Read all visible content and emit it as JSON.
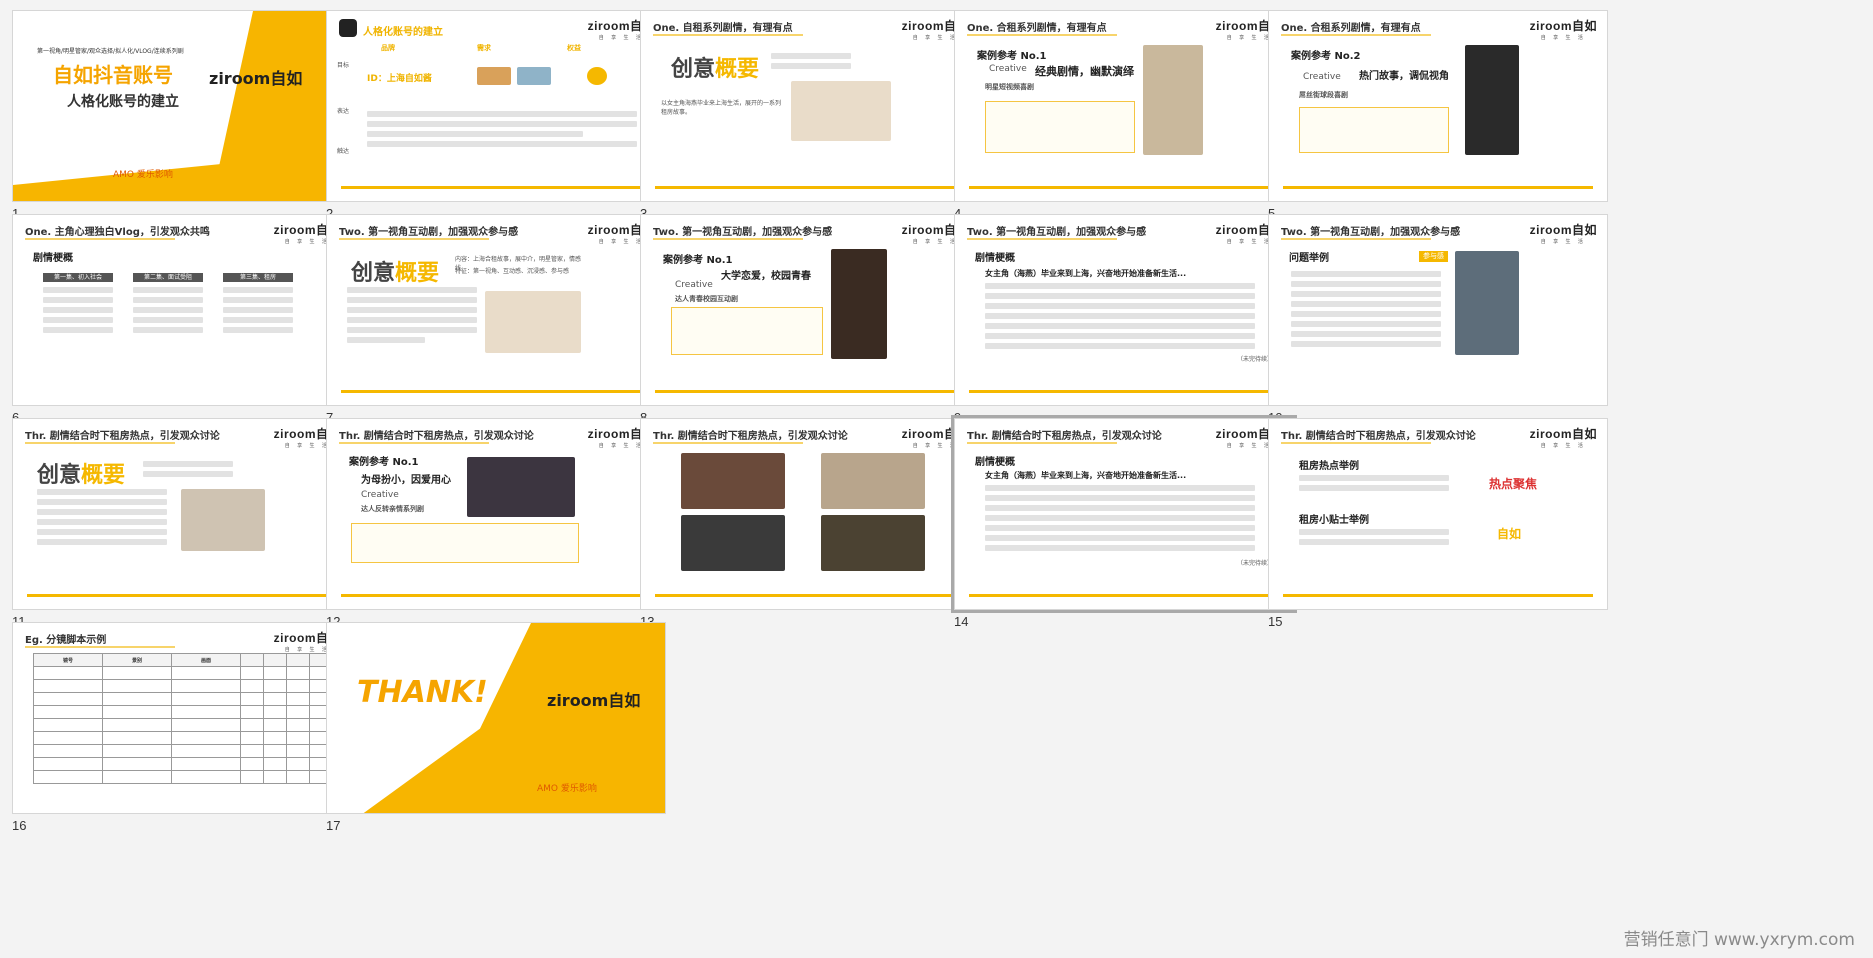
{
  "slides": [
    {
      "num": "1",
      "line1": "第一视角/明星管家/观众选择/拟人化/VLOG/连续系列剧",
      "title": "自如抖音账号",
      "subtitle": "人格化账号的建立",
      "logo": "ziroom自如",
      "brand": "AMO 爱乐影响"
    },
    {
      "num": "2",
      "title": "人格化账号的建立",
      "col1": "品牌",
      "col2": "需求",
      "col3": "权益",
      "id": "ID：上海自如酱",
      "r1": "目标",
      "r2": "表达",
      "r3": "触达"
    },
    {
      "num": "3",
      "header": "One. 自租系列剧情，有理有点",
      "big1": "创意",
      "big2": "概要",
      "text": "以女主角海燕毕业来上海生活，展开的一系列租房故事。"
    },
    {
      "num": "4",
      "header": "One. 合租系列剧情，有理有点",
      "case": "案例参考 No.1",
      "creative": "Creative",
      "slogan": "经典剧情，幽默演绎",
      "tag": "明星短视频喜剧"
    },
    {
      "num": "5",
      "header": "One. 合租系列剧情，有理有点",
      "case": "案例参考 No.2",
      "creative": "Creative",
      "slogan": "热门故事，调侃视角",
      "tag": "屌丝街球段喜剧"
    },
    {
      "num": "6",
      "header": "One. 主角心理独白Vlog，引发观众共鸣",
      "label": "剧情梗概",
      "c1": "第一集、初入社会",
      "c2": "第二集、面试受阻",
      "c3": "第三集、租房"
    },
    {
      "num": "7",
      "header": "Two. 第一视角互动剧，加强观众参与感",
      "big1": "创意",
      "big2": "概要",
      "meta1": "内容：上海合租故事，展中介，明星管家，情感线",
      "meta2": "特征：第一视角、互动感、沉浸感、参与感"
    },
    {
      "num": "8",
      "header": "Two. 第一视角互动剧，加强观众参与感",
      "case": "案例参考 No.1",
      "slogan": "大学恋爱，校园青春",
      "creative": "Creative",
      "tag": "达人青春校园互动剧"
    },
    {
      "num": "9",
      "header": "Two. 第一视角互动剧，加强观众参与感",
      "label": "剧情梗概",
      "lead": "女主角（海燕）毕业来到上海，兴奋地开始准备新生活...",
      "end": "（未完待续）"
    },
    {
      "num": "10",
      "header": "Two. 第一视角互动剧，加强观众参与感",
      "label": "问题举例",
      "badge": "参与感"
    },
    {
      "num": "11",
      "header": "Thr. 剧情结合时下租房热点，引发观众讨论",
      "big1": "创意",
      "big2": "概要"
    },
    {
      "num": "12",
      "header": "Thr. 剧情结合时下租房热点，引发观众讨论",
      "case": "案例参考 No.1",
      "slogan": "为母扮小，因爱用心",
      "creative": "Creative",
      "tag": "达人反转亲情系列剧"
    },
    {
      "num": "13",
      "header": "Thr. 剧情结合时下租房热点，引发观众讨论"
    },
    {
      "num": "14",
      "header": "Thr. 剧情结合时下租房热点，引发观众讨论",
      "label": "剧情梗概",
      "lead": "女主角（海燕）毕业来到上海，兴奋地开始准备新生活...",
      "end": "（未完待续）"
    },
    {
      "num": "15",
      "header": "Thr. 剧情结合时下租房热点，引发观众讨论",
      "l1": "租房热点举例",
      "l2": "租房小贴士举例",
      "tag1": "热点聚焦",
      "tag2": "自如"
    },
    {
      "num": "16",
      "header": "Eg. 分镜脚本示例",
      "cols": [
        "镜号",
        "景别",
        "画面"
      ]
    },
    {
      "num": "17",
      "thank": "THANK!",
      "logo": "ziroom自如",
      "brand": "AMO 爱乐影响"
    }
  ],
  "watermark": "营销任意门 www.yxrym.com",
  "colors": {
    "accent": "#f5b800",
    "text": "#333333"
  }
}
